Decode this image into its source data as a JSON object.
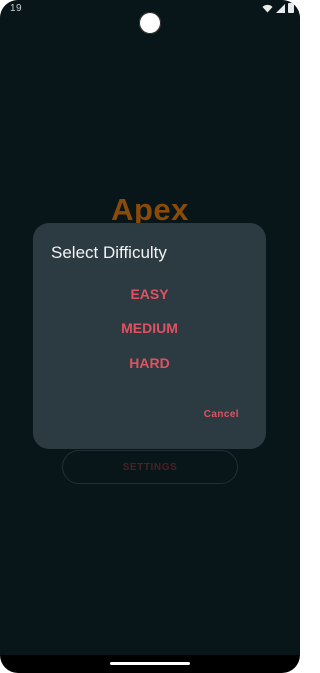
{
  "status_bar": {
    "time": "19",
    "icons": [
      "wifi-icon",
      "signal-icon",
      "battery-icon"
    ]
  },
  "app": {
    "title": "Apex",
    "settings_label": "SETTINGS"
  },
  "dialog": {
    "title": "Select Difficulty",
    "options": [
      {
        "label": "EASY"
      },
      {
        "label": "MEDIUM"
      },
      {
        "label": "HARD"
      }
    ],
    "cancel_label": "Cancel"
  },
  "colors": {
    "background": "#081619",
    "dialog": "#2c3a41",
    "accent": "#e05262",
    "title_brand": "#8a4a08"
  }
}
